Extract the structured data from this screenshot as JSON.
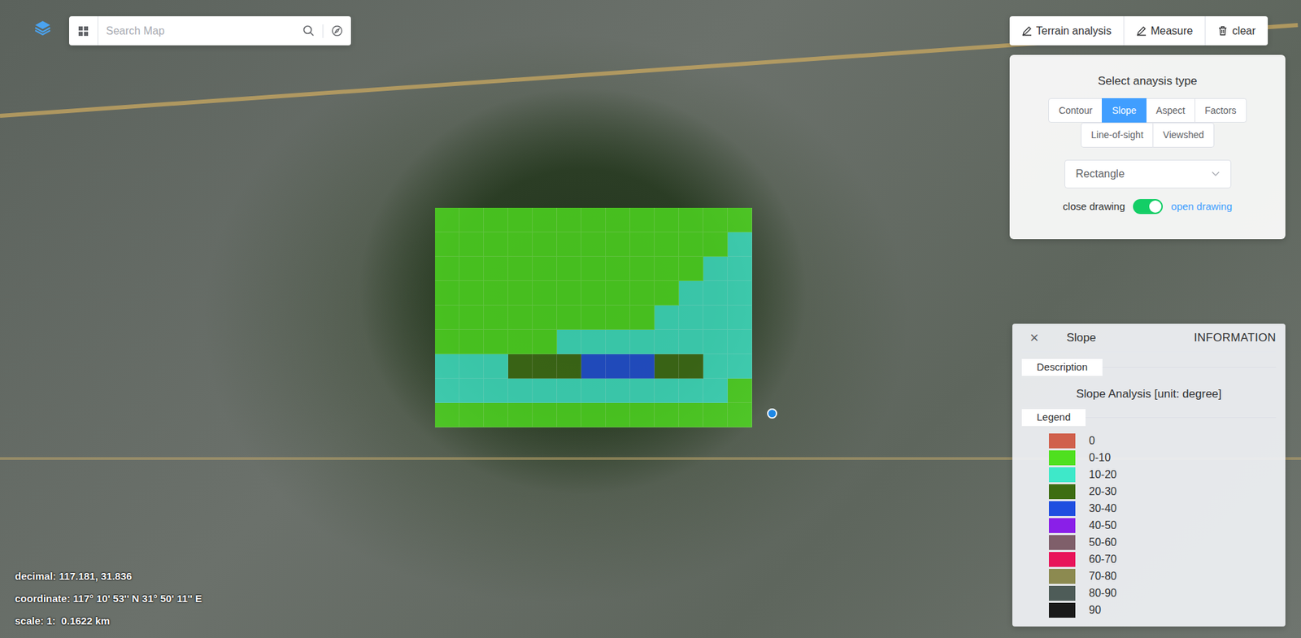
{
  "search": {
    "placeholder": "Search Map"
  },
  "toolbar": [
    {
      "label": "Terrain analysis"
    },
    {
      "label": "Measure"
    },
    {
      "label": "clear"
    }
  ],
  "analysis_panel": {
    "title": "Select anaysis type",
    "type_rows": [
      [
        {
          "label": "Contour",
          "selected": false
        },
        {
          "label": "Slope",
          "selected": true
        },
        {
          "label": "Aspect",
          "selected": false
        },
        {
          "label": "Factors",
          "selected": false
        }
      ],
      [
        {
          "label": "Line-of-sight",
          "selected": false
        },
        {
          "label": "Viewshed",
          "selected": false
        }
      ]
    ],
    "shape": "Rectangle",
    "drawing": {
      "off_label": "close drawing",
      "on_label": "open drawing",
      "on": true
    }
  },
  "info_panel": {
    "close": "×",
    "title": "Slope",
    "header": "INFORMATION",
    "section": "Description",
    "description": "Slope Analysis [unit: degree]",
    "legend_title": "Legend",
    "legend": [
      {
        "label": "0",
        "color": "#d0604c"
      },
      {
        "label": "0-10",
        "color": "#4fe01f"
      },
      {
        "label": "10-20",
        "color": "#3ee8c9"
      },
      {
        "label": "20-30",
        "color": "#3d6d12"
      },
      {
        "label": "30-40",
        "color": "#1f4ee0"
      },
      {
        "label": "40-50",
        "color": "#8a1fe8"
      },
      {
        "label": "50-60",
        "color": "#7f5f6a"
      },
      {
        "label": "60-70",
        "color": "#e8145a"
      },
      {
        "label": "70-80",
        "color": "#8c8a50"
      },
      {
        "label": "80-90",
        "color": "#4e5c58"
      },
      {
        "label": "90",
        "color": "#1a1a1a"
      }
    ]
  },
  "slope_grid": {
    "rows": [
      [
        1,
        1,
        1,
        1,
        1,
        1,
        1,
        1,
        1,
        1,
        1,
        1,
        1
      ],
      [
        1,
        1,
        1,
        1,
        1,
        1,
        1,
        1,
        1,
        1,
        1,
        1,
        2
      ],
      [
        1,
        1,
        1,
        1,
        1,
        1,
        1,
        1,
        1,
        1,
        1,
        2,
        2
      ],
      [
        1,
        1,
        1,
        1,
        1,
        1,
        1,
        1,
        1,
        1,
        2,
        2,
        2
      ],
      [
        1,
        1,
        1,
        1,
        1,
        1,
        1,
        1,
        1,
        2,
        2,
        2,
        2
      ],
      [
        1,
        1,
        1,
        1,
        1,
        2,
        2,
        2,
        2,
        2,
        2,
        2,
        2
      ],
      [
        2,
        2,
        2,
        3,
        3,
        3,
        4,
        4,
        4,
        3,
        3,
        2,
        2
      ],
      [
        2,
        2,
        2,
        2,
        2,
        2,
        2,
        2,
        2,
        2,
        2,
        2,
        1
      ],
      [
        1,
        1,
        1,
        1,
        1,
        1,
        1,
        1,
        1,
        1,
        1,
        1,
        1
      ]
    ]
  },
  "status": {
    "decimal": "decimal: 117.181, 31.836",
    "coordinate": "coordinate: 117° 10' 53'' N 31° 50' 11'' E",
    "scale": "scale: 1:  0.1622 km"
  }
}
